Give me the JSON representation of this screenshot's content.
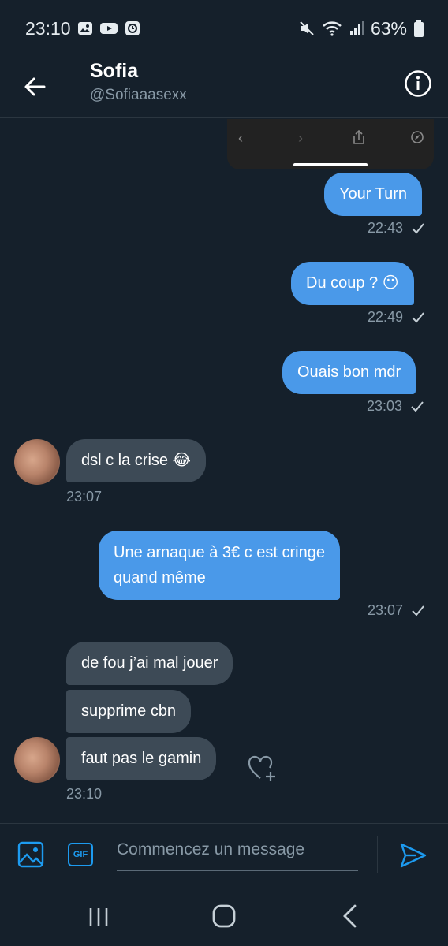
{
  "status_bar": {
    "time": "23:10",
    "battery": "63%",
    "icons": [
      "image-icon",
      "youtube-icon",
      "clock-icon",
      "mute-icon",
      "wifi-icon",
      "signal-icon",
      "battery-icon"
    ]
  },
  "header": {
    "name": "Sofia",
    "handle": "@Sofiaaasexx",
    "icons": [
      "back-arrow-icon",
      "info-icon"
    ]
  },
  "messages": [
    {
      "dir": "out",
      "text": "Your Turn",
      "time": "22:43"
    },
    {
      "dir": "out",
      "text": "Du coup ? 😶",
      "time": "22:49"
    },
    {
      "dir": "out",
      "text": "Ouais bon mdr",
      "time": "23:03"
    },
    {
      "dir": "in",
      "text": "dsl c la crise 😂",
      "time": "23:07"
    },
    {
      "dir": "out",
      "text_lines": [
        "Une arnaque à 3€ c est cringe",
        "quand même"
      ],
      "time": "23:07"
    },
    {
      "dir": "in",
      "text": "de fou j’ai mal jouer"
    },
    {
      "dir": "in",
      "text": "supprime cbn"
    },
    {
      "dir": "in",
      "text": "faut pas le gamin",
      "time": "23:10"
    }
  ],
  "composer": {
    "placeholder": "Commencez un message",
    "gif_label": "GIF",
    "icons": [
      "image-icon",
      "gif-icon",
      "send-icon"
    ]
  },
  "colors": {
    "background": "#15202b",
    "outgoing_bubble": "#4a99e9",
    "incoming_bubble": "#3d4a56",
    "accent": "#1d9bf0",
    "muted_text": "#8899a6"
  }
}
